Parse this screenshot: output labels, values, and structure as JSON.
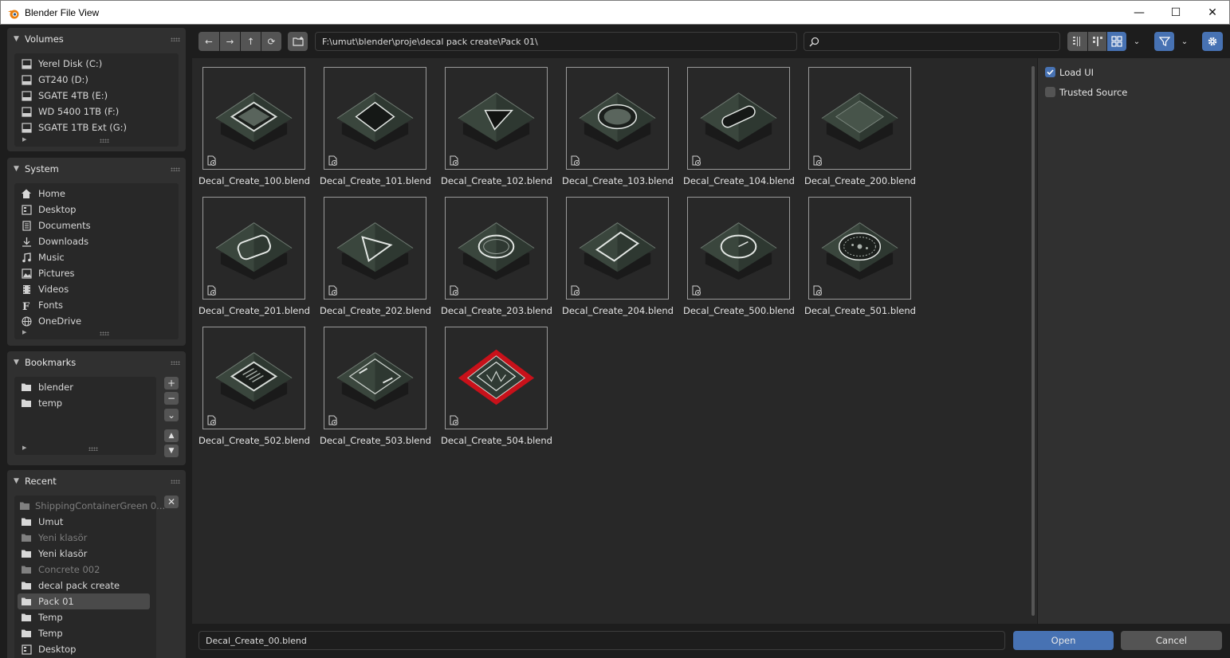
{
  "window": {
    "title": "Blender File View",
    "minimize": "—",
    "maximize": "☐",
    "close": "✕"
  },
  "sidebar": {
    "volumes": {
      "title": "Volumes",
      "items": [
        {
          "label": "Yerel Disk (C:)",
          "icon": "drive-icon"
        },
        {
          "label": "GT240 (D:)",
          "icon": "drive-icon"
        },
        {
          "label": "SGATE 4TB (E:)",
          "icon": "drive-icon"
        },
        {
          "label": "WD 5400 1TB (F:)",
          "icon": "drive-icon"
        },
        {
          "label": "SGATE 1TB Ext (G:)",
          "icon": "drive-icon"
        }
      ]
    },
    "system": {
      "title": "System",
      "items": [
        {
          "label": "Home",
          "icon": "home-icon"
        },
        {
          "label": "Desktop",
          "icon": "desktop-icon"
        },
        {
          "label": "Documents",
          "icon": "documents-icon"
        },
        {
          "label": "Downloads",
          "icon": "downloads-icon"
        },
        {
          "label": "Music",
          "icon": "music-icon"
        },
        {
          "label": "Pictures",
          "icon": "pictures-icon"
        },
        {
          "label": "Videos",
          "icon": "videos-icon"
        },
        {
          "label": "Fonts",
          "icon": "fonts-icon"
        },
        {
          "label": "OneDrive",
          "icon": "globe-icon"
        }
      ]
    },
    "bookmarks": {
      "title": "Bookmarks",
      "items": [
        {
          "label": "blender",
          "icon": "folder-icon"
        },
        {
          "label": "temp",
          "icon": "folder-icon"
        }
      ],
      "add": "+",
      "remove": "−",
      "menu": "⌄",
      "up": "▲",
      "down": "▼"
    },
    "recent": {
      "title": "Recent",
      "clear": "✕",
      "items": [
        {
          "label": "ShippingContainerGreen 0...",
          "dim": true,
          "active": false
        },
        {
          "label": "Umut",
          "dim": false,
          "active": false
        },
        {
          "label": "Yeni klasör",
          "dim": true,
          "active": false
        },
        {
          "label": "Yeni klasör",
          "dim": false,
          "active": false
        },
        {
          "label": "Concrete 002",
          "dim": true,
          "active": false
        },
        {
          "label": "decal pack create",
          "dim": false,
          "active": false
        },
        {
          "label": "Pack 01",
          "dim": false,
          "active": true
        },
        {
          "label": "Temp",
          "dim": false,
          "active": false
        },
        {
          "label": "Temp",
          "dim": false,
          "active": false
        },
        {
          "label": "Desktop",
          "dim": false,
          "active": false,
          "icon": "desktop-icon"
        }
      ]
    }
  },
  "toolbar": {
    "back": "←",
    "forward": "→",
    "parent": "↑",
    "refresh": "⟳",
    "path": "F:\\umut\\blender\\proje\\decal pack create\\Pack 01\\",
    "search_value": ""
  },
  "files": [
    {
      "name": "Decal_Create_100.blend",
      "shape": "tray"
    },
    {
      "name": "Decal_Create_101.blend",
      "shape": "diamond"
    },
    {
      "name": "Decal_Create_102.blend",
      "shape": "triangle"
    },
    {
      "name": "Decal_Create_103.blend",
      "shape": "circle"
    },
    {
      "name": "Decal_Create_104.blend",
      "shape": "pill"
    },
    {
      "name": "Decal_Create_200.blend",
      "shape": "flat"
    },
    {
      "name": "Decal_Create_201.blend",
      "shape": "roundrect"
    },
    {
      "name": "Decal_Create_202.blend",
      "shape": "triangle-outline"
    },
    {
      "name": "Decal_Create_203.blend",
      "shape": "ring"
    },
    {
      "name": "Decal_Create_204.blend",
      "shape": "diamond-outline"
    },
    {
      "name": "Decal_Create_500.blend",
      "shape": "clock"
    },
    {
      "name": "Decal_Create_501.blend",
      "shape": "vent"
    },
    {
      "name": "Decal_Create_502.blend",
      "shape": "grill"
    },
    {
      "name": "Decal_Create_503.blend",
      "shape": "panel"
    },
    {
      "name": "Decal_Create_504.blend",
      "shape": "red"
    }
  ],
  "options": {
    "load_ui": {
      "label": "Load UI",
      "checked": true
    },
    "trusted_source": {
      "label": "Trusted Source",
      "checked": false
    }
  },
  "footer": {
    "filename": "Decal_Create_00.blend",
    "open": "Open",
    "cancel": "Cancel"
  },
  "colors": {
    "accent": "#4772b3",
    "panel": "#303030",
    "list": "#282828",
    "button": "#545454",
    "red": "#c8111a"
  }
}
